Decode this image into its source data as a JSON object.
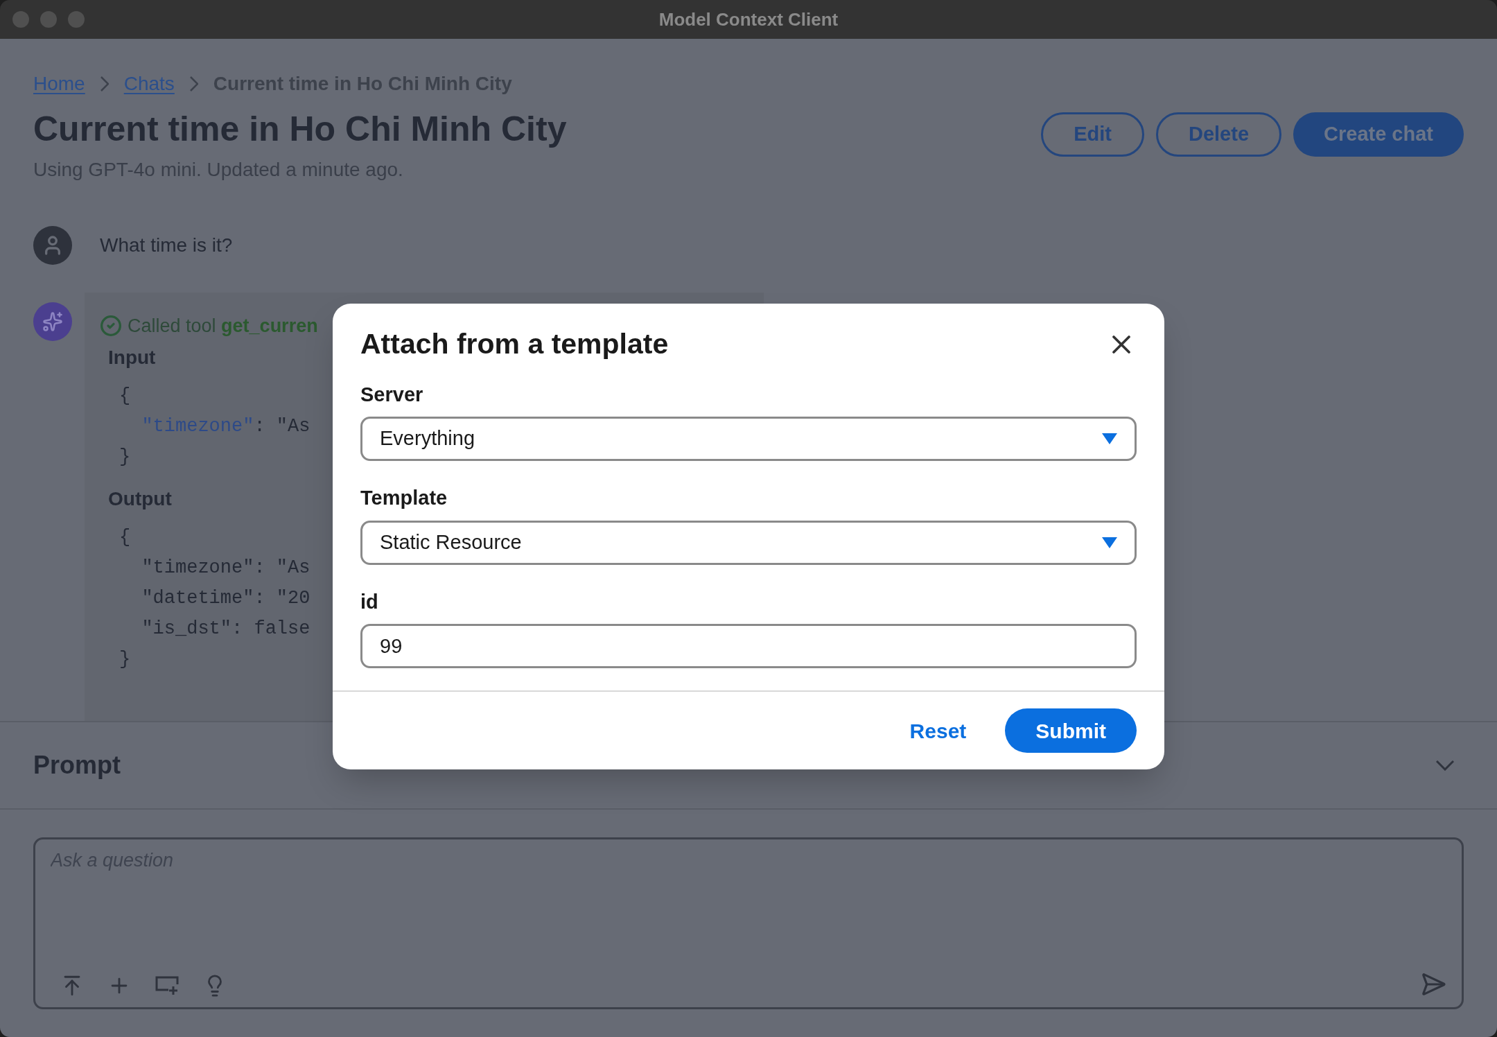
{
  "window": {
    "title": "Model Context Client"
  },
  "breadcrumb": [
    {
      "label": "Home",
      "kind": "link"
    },
    {
      "label": "Chats",
      "kind": "link"
    },
    {
      "label": "Current time in Ho Chi Minh City",
      "kind": "current"
    }
  ],
  "page": {
    "title": "Current time in Ho Chi Minh City",
    "subtitle": "Using GPT-4o mini. Updated a minute ago.",
    "buttons": [
      {
        "label": "Edit",
        "kind": "outline"
      },
      {
        "label": "Delete",
        "kind": "outline"
      },
      {
        "label": "Create chat",
        "kind": "primary"
      }
    ]
  },
  "messages": [
    {
      "kind": "user",
      "text": "What time is it?"
    },
    {
      "kind": "assistant",
      "tool_status": "Called tool ",
      "tool_name": "get_curren",
      "blocks": [
        {
          "label": "Input",
          "highlight_keys": true,
          "lines": [
            {
              "text": "{"
            },
            {
              "key": "  \"timezone\"",
              "rest": ": \"As"
            },
            {
              "text": "}"
            }
          ]
        },
        {
          "label": "Output",
          "highlight_keys": false,
          "lines": [
            {
              "text": "{"
            },
            {
              "key": "  \"timezone\"",
              "rest": ": \"As"
            },
            {
              "key": "  \"datetime\"",
              "rest": ": \"20"
            },
            {
              "key": "  \"is_dst\"",
              "rest": ": false"
            },
            {
              "text": "}"
            }
          ]
        }
      ]
    }
  ],
  "prompt": {
    "title": "Prompt",
    "expanded": false,
    "placeholder": "Ask a question"
  },
  "dialog": {
    "title": "Attach from a template",
    "fields": [
      {
        "label": "Server",
        "kind": "select",
        "value": "Everything"
      },
      {
        "label": "Template",
        "kind": "select",
        "value": "Static Resource"
      },
      {
        "label": "id",
        "kind": "text",
        "value": "99"
      }
    ],
    "buttons": [
      {
        "label": "Reset",
        "kind": "link"
      },
      {
        "label": "Submit",
        "kind": "primary"
      }
    ]
  }
}
